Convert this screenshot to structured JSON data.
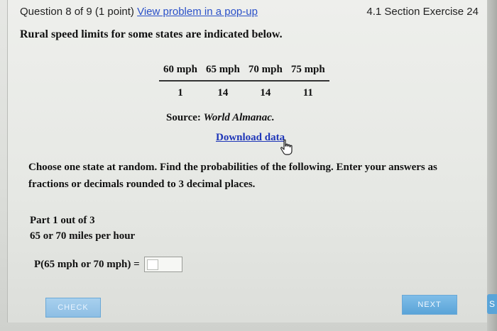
{
  "header": {
    "question_label": "Question 8 of 9 (1 point)",
    "popup_link": "View problem in a pop-up",
    "section": "4.1 Section Exercise 24"
  },
  "problem": {
    "intro": "Rural speed limits for some states are indicated below.",
    "table": {
      "headers": [
        "60 mph",
        "65 mph",
        "70 mph",
        "75 mph"
      ],
      "values": [
        "1",
        "14",
        "14",
        "11"
      ]
    },
    "source_label": "Source:",
    "source_name": "World Almanac.",
    "download_link": "Download data",
    "instructions": "Choose one state at random. Find the probabilities of the following. Enter your answers as fractions or decimals rounded to 3 decimal places."
  },
  "part": {
    "label": "Part 1 out of 3",
    "description": "65 or 70 miles per hour",
    "prob_label": "P(65 mph or 70 mph) =",
    "answer_value": ""
  },
  "buttons": {
    "check": "CHECK",
    "next": "NEXT",
    "side": "S"
  },
  "icons": {
    "cursor": "hand-pointer-icon"
  },
  "colors": {
    "link": "#2a50c8",
    "button": "#5aa4d8"
  }
}
